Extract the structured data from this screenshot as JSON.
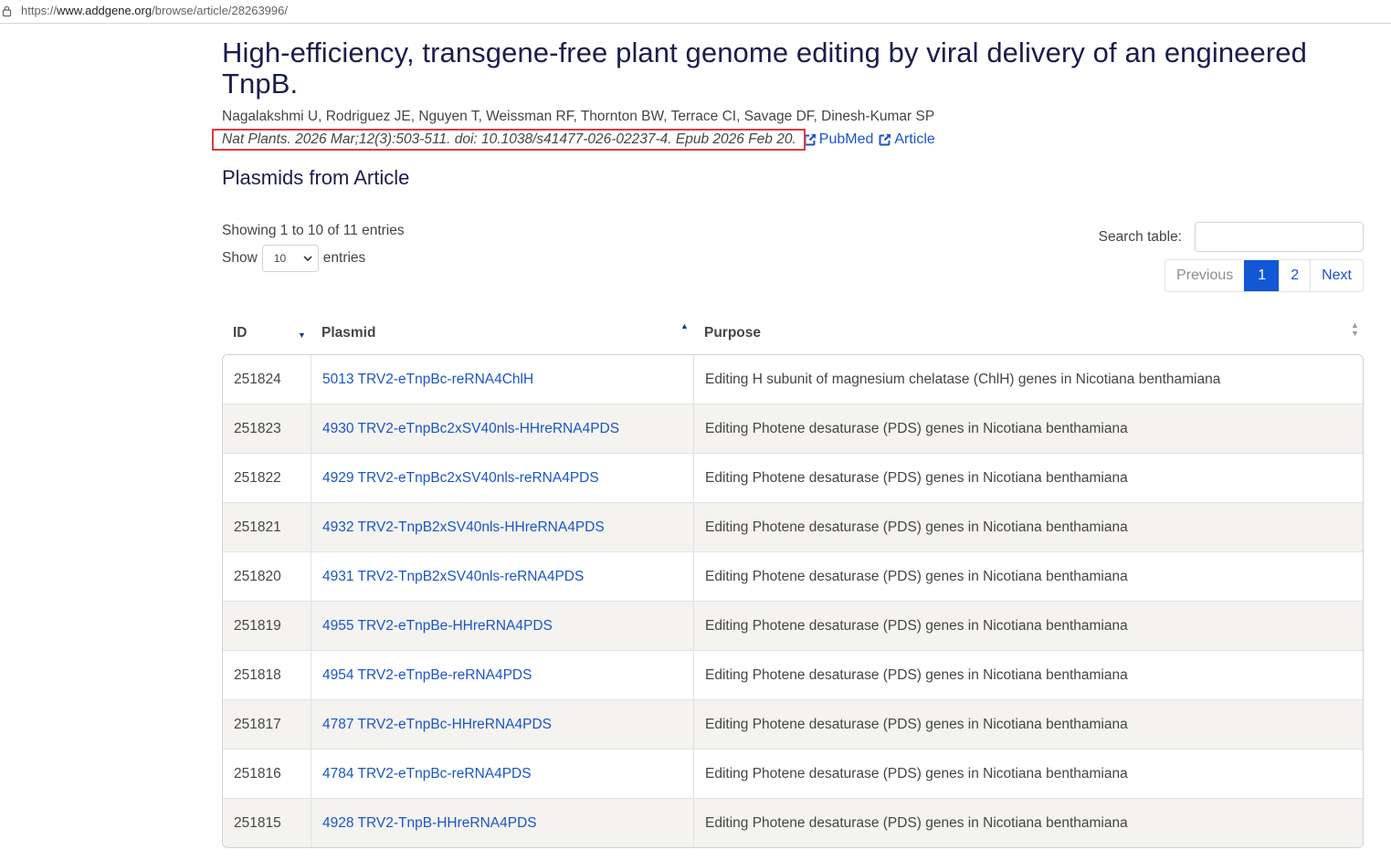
{
  "browser": {
    "url_prefix": "https://",
    "url_host": "www.addgene.org",
    "url_path": "/browse/article/28263996/"
  },
  "article": {
    "title": "High-efficiency, transgene-free plant genome editing by viral delivery of an engineered TnpB.",
    "authors": "Nagalakshmi U, Rodriguez JE, Nguyen T, Weissman RF, Thornton BW, Terrace CI, Savage DF, Dinesh-Kumar SP",
    "citation": "Nat Plants. 2026 Mar;12(3):503-511. doi: 10.1038/s41477-026-02237-4. Epub 2026 Feb 20.",
    "pubmed_label": "PubMed",
    "article_label": "Article",
    "highlight_color": "#e1393d"
  },
  "section": {
    "title": "Plasmids from Article"
  },
  "table_controls": {
    "showing": "Showing 1 to 10 of 11 entries",
    "show_label": "Show",
    "entries_label": "entries",
    "length_value": "10",
    "search_label": "Search table:",
    "search_value": "",
    "pagination": {
      "previous": "Previous",
      "pages": [
        "1",
        "2"
      ],
      "active_page": "1",
      "next": "Next"
    }
  },
  "table": {
    "headers": {
      "id": "ID",
      "plasmid": "Plasmid",
      "purpose": "Purpose"
    },
    "rows": [
      {
        "id": "251824",
        "plasmid": "5013 TRV2-eTnpBc-reRNA4ChlH",
        "purpose": "Editing H subunit of magnesium chelatase (ChlH) genes in Nicotiana benthamiana"
      },
      {
        "id": "251823",
        "plasmid": "4930 TRV2-eTnpBc2xSV40nls-HHreRNA4PDS",
        "purpose": "Editing Photene desaturase (PDS) genes in Nicotiana benthamiana"
      },
      {
        "id": "251822",
        "plasmid": "4929 TRV2-eTnpBc2xSV40nls-reRNA4PDS",
        "purpose": "Editing Photene desaturase (PDS) genes in Nicotiana benthamiana"
      },
      {
        "id": "251821",
        "plasmid": "4932 TRV2-TnpB2xSV40nls-HHreRNA4PDS",
        "purpose": "Editing Photene desaturase (PDS) genes in Nicotiana benthamiana"
      },
      {
        "id": "251820",
        "plasmid": "4931 TRV2-TnpB2xSV40nls-reRNA4PDS",
        "purpose": "Editing Photene desaturase (PDS) genes in Nicotiana benthamiana"
      },
      {
        "id": "251819",
        "plasmid": "4955 TRV2-eTnpBe-HHreRNA4PDS",
        "purpose": "Editing Photene desaturase (PDS) genes in Nicotiana benthamiana"
      },
      {
        "id": "251818",
        "plasmid": "4954 TRV2-eTnpBe-reRNA4PDS",
        "purpose": "Editing Photene desaturase (PDS) genes in Nicotiana benthamiana"
      },
      {
        "id": "251817",
        "plasmid": "4787 TRV2-eTnpBc-HHreRNA4PDS",
        "purpose": "Editing Photene desaturase (PDS) genes in Nicotiana benthamiana"
      },
      {
        "id": "251816",
        "plasmid": "4784 TRV2-eTnpBc-reRNA4PDS",
        "purpose": "Editing Photene desaturase (PDS) genes in Nicotiana benthamiana"
      },
      {
        "id": "251815",
        "plasmid": "4928 TRV2-TnpB-HHreRNA4PDS",
        "purpose": "Editing Photene desaturase (PDS) genes in Nicotiana benthamiana"
      }
    ]
  },
  "colors": {
    "accent": "#1257d4",
    "link": "#1a55c8",
    "heading": "#1b1d4d",
    "row_stripe": "#f4f3f0"
  }
}
